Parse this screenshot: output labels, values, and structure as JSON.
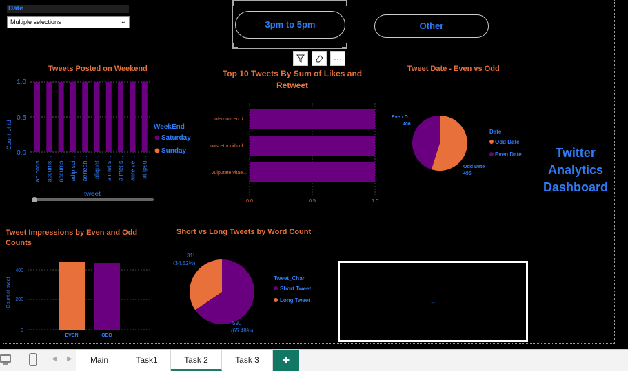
{
  "date_slicer": {
    "header": "Date",
    "selected": "Multiple selections"
  },
  "time_buttons": {
    "primary": "3pm to 5pm",
    "secondary": "Other"
  },
  "visual_toolbar": {
    "filter_icon": "filter-icon",
    "eraser_icon": "eraser-icon",
    "more_icon": "more-options-icon",
    "more_label": "···"
  },
  "dashboard_title": {
    "line1": "Twitter",
    "line2": "Analytics",
    "line3": "Dashboard"
  },
  "colors": {
    "purple": "#6a0080",
    "orange": "#e8703a",
    "blue": "#2f7cf6",
    "title": "#e8703a"
  },
  "weekend_chart": {
    "title": "Tweets Posted on Weekend",
    "ylabel": "Count of id",
    "xlabel": "tweet",
    "legend_title": "WeekEnd",
    "legend": [
      "Saturday",
      "Sunday"
    ],
    "y_ticks": [
      "1.0",
      "0.5",
      "0.0"
    ]
  },
  "top10_chart": {
    "title_line1": "Top 10 Tweets By Sum of Likes and",
    "title_line2": "Retweet",
    "x_ticks": [
      "0.0",
      "0.5",
      "1.0"
    ]
  },
  "date_pie": {
    "title": "Tweet Date - Even vs Odd",
    "legend_title": "Date",
    "legend": [
      "Odd Date",
      "Even Date"
    ],
    "even_label": "Even D...",
    "even_value": "406",
    "odd_label": "Odd Date",
    "odd_value": "495"
  },
  "impressions_chart": {
    "title_line1": "Tweet Impressions by Even and Odd",
    "title_line2": "Counts",
    "ylabel": "Count of tweet",
    "y_ticks": [
      "400",
      "200",
      "0"
    ]
  },
  "wordcount_pie": {
    "title": "Short vs Long Tweets by Word Count",
    "legend_title": "Tweet_Char",
    "legend": [
      "Short Tweet",
      "Long Tweet"
    ],
    "long_value": "311",
    "long_pct": "(34.52%)",
    "short_value": "590",
    "short_pct": "(65.48%)"
  },
  "empty_card": {
    "text": "--"
  },
  "page_tabs": [
    "Main",
    "Task1",
    "Task 2",
    "Task 3"
  ],
  "add_tab_label": "+",
  "chart_data": [
    {
      "type": "bar",
      "title": "Tweets Posted on Weekend",
      "xlabel": "tweet",
      "ylabel": "Count of id",
      "categories": [
        "ac cons...",
        "accums...",
        "accums...",
        "adipisci...",
        "aenean...",
        "aliquet...",
        "a met s...",
        "a met s...",
        "ante ve...",
        "at ipsu..."
      ],
      "series": [
        {
          "name": "Saturday",
          "values": [
            1,
            1,
            1,
            1,
            1,
            1,
            1,
            1,
            1,
            1
          ]
        }
      ],
      "ylim": [
        0,
        1
      ]
    },
    {
      "type": "bar",
      "title": "Top 10 Tweets By Sum of Likes and Retweet",
      "categories": [
        "interdum eu ti...",
        "nascetur ridicul...",
        "vulputate vitae..."
      ],
      "values": [
        1,
        1,
        1
      ],
      "xlim": [
        0,
        1
      ]
    },
    {
      "type": "pie",
      "title": "Tweet Date - Even vs Odd",
      "labels": [
        "Odd Date",
        "Even Date"
      ],
      "values": [
        495,
        406
      ]
    },
    {
      "type": "bar",
      "title": "Tweet Impressions by Even and Odd Counts",
      "ylabel": "Count of tweet",
      "categories": [
        "EVEN",
        "ODD"
      ],
      "values": [
        450,
        445
      ],
      "ylim": [
        0,
        450
      ]
    },
    {
      "type": "pie",
      "title": "Short vs Long Tweets by Word Count",
      "labels": [
        "Short Tweet",
        "Long Tweet"
      ],
      "values": [
        590,
        311
      ]
    }
  ]
}
